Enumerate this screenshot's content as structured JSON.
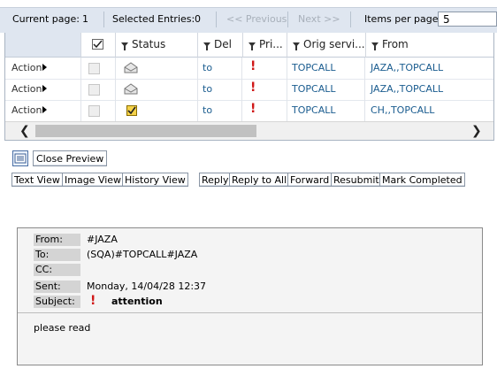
{
  "toolbar": {
    "current_page_label": "Current page:",
    "current_page_value": "1",
    "selected_entries_label": "Selected Entries:",
    "selected_entries_value": "0",
    "previous_label": "<< Previous",
    "next_label": "Next >>",
    "items_per_page_label": "Items per page:",
    "items_per_page_value": "5"
  },
  "grid": {
    "columns": [
      {
        "label": "",
        "icon": "checkmark-column-icon"
      },
      {
        "label": "Status",
        "icon": "filter-icon"
      },
      {
        "label": "Del",
        "icon": "filter-icon"
      },
      {
        "label": "Pri...",
        "icon": "filter-icon"
      },
      {
        "label": "Orig servi...",
        "icon": "filter-icon"
      },
      {
        "label": "From",
        "icon": "filter-icon"
      }
    ],
    "rows": [
      {
        "action": "Action",
        "status_icon": "envelope-open-icon",
        "del": "to",
        "priority_icon": "exclamation-icon",
        "orig_service": "TOPCALL",
        "from": "JAZA,,TOPCALL"
      },
      {
        "action": "Action",
        "status_icon": "envelope-open-icon",
        "del": "to",
        "priority_icon": "exclamation-icon",
        "orig_service": "TOPCALL",
        "from": "JAZA,,TOPCALL"
      },
      {
        "action": "Action",
        "status_icon": "checkmark-status-icon",
        "del": "to",
        "priority_icon": "exclamation-icon",
        "orig_service": "TOPCALL",
        "from": "CH,,TOPCALL"
      }
    ]
  },
  "preview_controls": {
    "close_preview_label": "Close Preview"
  },
  "view_buttons": {
    "text_view": "Text View",
    "image_view": "Image View",
    "history_view": "History View"
  },
  "action_buttons": {
    "reply": "Reply",
    "reply_all": "Reply to All",
    "forward": "Forward",
    "resubmit": "Resubmit",
    "mark_completed": "Mark Completed"
  },
  "message": {
    "from_label": "From:",
    "from_value": "#JAZA",
    "to_label": "To:",
    "to_value": "(SQA)#TOPCALL#JAZA",
    "cc_label": "CC:",
    "cc_value": "",
    "sent_label": "Sent:",
    "sent_value": "Monday, 14/04/28 12:37",
    "subject_label": "Subject:",
    "subject_value": "attention",
    "body": "please read"
  },
  "colors": {
    "toolbar_bg": "#dfe6f0",
    "grid_text": "#1a5c8f",
    "priority": "#d01818"
  }
}
